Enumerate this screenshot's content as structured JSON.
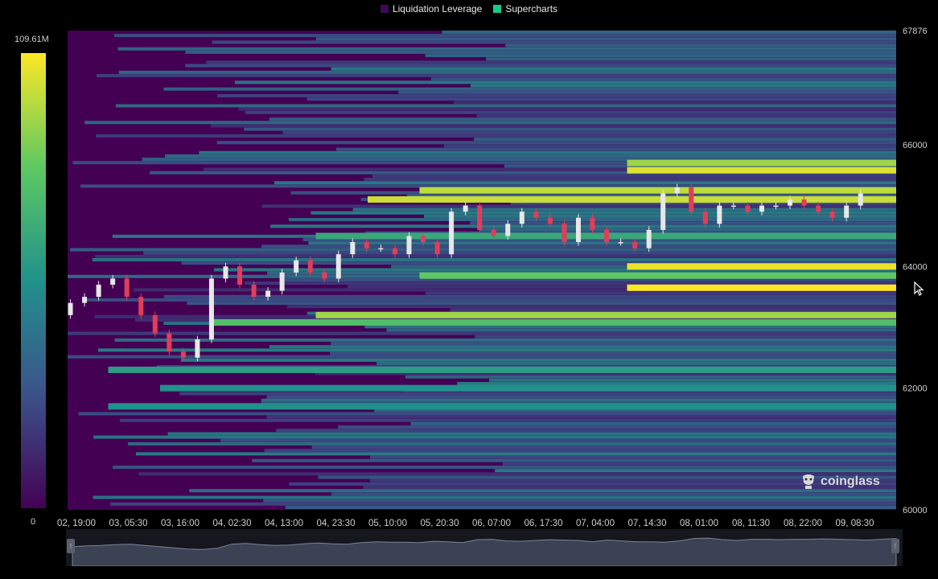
{
  "legend": {
    "items": [
      {
        "label": "Liquidation Leverage",
        "color": "#3b0a57"
      },
      {
        "label": "Supercharts",
        "color": "#19c98a"
      }
    ]
  },
  "colorbar": {
    "max_label": "109.61M",
    "min_label": "0"
  },
  "watermark": {
    "text": "coinglass"
  },
  "chart_data": {
    "type": "heatmap",
    "title": "",
    "colorscale": "viridis",
    "color_range": [
      0,
      109.61
    ],
    "color_unit": "M",
    "y_ticks": [
      "67876",
      "66000",
      "64000",
      "62000",
      "60000"
    ],
    "ylim": [
      60000,
      67876
    ],
    "x_ticks": [
      "02, 19:00",
      "03, 05:30",
      "03, 16:00",
      "04, 02:30",
      "04, 13:00",
      "04, 23:30",
      "05, 10:00",
      "05, 20:30",
      "06, 07:00",
      "06, 17:30",
      "07, 04:00",
      "07, 14:30",
      "08, 01:00",
      "08, 11:30",
      "08, 22:00",
      "09, 08:30"
    ],
    "liquidation_bands": [
      {
        "price": 65580,
        "intensity": 0.95,
        "start_tick": 11
      },
      {
        "price": 65700,
        "intensity": 0.85,
        "start_tick": 11
      },
      {
        "price": 65250,
        "intensity": 0.9,
        "start_tick": 7
      },
      {
        "price": 65100,
        "intensity": 0.92,
        "start_tick": 6
      },
      {
        "price": 64000,
        "intensity": 0.97,
        "start_tick": 11
      },
      {
        "price": 63850,
        "intensity": 0.75,
        "start_tick": 7
      },
      {
        "price": 63650,
        "intensity": 1.0,
        "start_tick": 11
      },
      {
        "price": 63200,
        "intensity": 0.85,
        "start_tick": 5
      },
      {
        "price": 63080,
        "intensity": 0.7,
        "start_tick": 3
      },
      {
        "price": 64500,
        "intensity": 0.6,
        "start_tick": 5
      },
      {
        "price": 62300,
        "intensity": 0.55,
        "start_tick": 1
      },
      {
        "price": 62000,
        "intensity": 0.5,
        "start_tick": 2
      },
      {
        "price": 61700,
        "intensity": 0.5,
        "start_tick": 1
      }
    ],
    "price_series": {
      "name": "",
      "x_start_tick": 0,
      "x_end_tick": 15.5,
      "values": [
        63200,
        63400,
        63500,
        63700,
        63800,
        63500,
        63200,
        62900,
        62600,
        62500,
        62800,
        63800,
        64000,
        63700,
        63500,
        63600,
        63900,
        64100,
        63900,
        63800,
        64200,
        64400,
        64300,
        64300,
        64200,
        64500,
        64400,
        64200,
        64900,
        65000,
        64600,
        64500,
        64700,
        64900,
        64800,
        64700,
        64400,
        64800,
        64600,
        64400,
        64400,
        64300,
        64600,
        65200,
        65300,
        64900,
        64700,
        65000,
        65000,
        64900,
        65000,
        65000,
        65100,
        65000,
        64900,
        64800,
        65000,
        65200
      ]
    }
  }
}
